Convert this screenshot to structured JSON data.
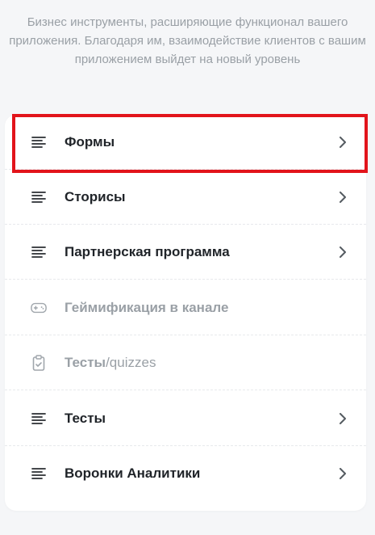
{
  "description": "Бизнес инструменты, расширяющие функционал вашего приложения. Благодаря им, взаимодействие клиентов с вашим приложением выйдет на новый уровень",
  "items": [
    {
      "label": "Формы",
      "icon": "lines-icon",
      "enabled": true
    },
    {
      "label": "Сторисы",
      "icon": "lines-icon",
      "enabled": true
    },
    {
      "label": "Партнерская программа",
      "icon": "lines-icon",
      "enabled": true
    },
    {
      "label": "Геймификация в канале",
      "icon": "gamepad-icon",
      "enabled": false
    },
    {
      "label": "Тесты",
      "label_tail": "/quizzes",
      "icon": "clipboard-icon",
      "enabled": false
    },
    {
      "label": "Тесты",
      "icon": "lines-icon",
      "enabled": true
    },
    {
      "label": "Воронки Аналитики",
      "icon": "lines-icon",
      "enabled": true
    }
  ],
  "colors": {
    "highlight": "#e2141b",
    "text": "#1f2328",
    "muted": "#9aa0a6"
  }
}
